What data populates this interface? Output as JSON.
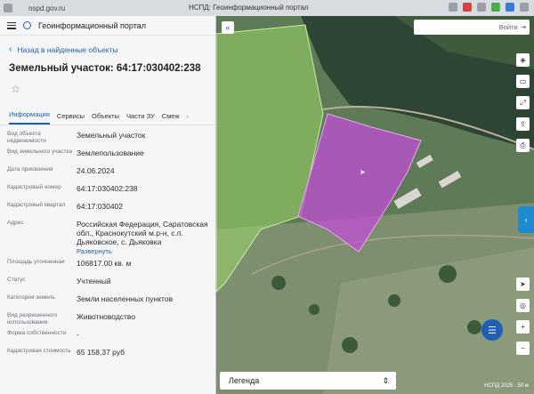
{
  "browser": {
    "url": "nspd.gov.ru",
    "window_title": "НСПД: Геоинформационный портал"
  },
  "panel": {
    "app_title": "Геоинформационный портал",
    "back_label": "Назад в найденные объекты",
    "object_title": "Земельный участок: 64:17:030402:238",
    "tabs": [
      {
        "label": "Информация"
      },
      {
        "label": "Сервисы"
      },
      {
        "label": "Объекты"
      },
      {
        "label": "Части ЗУ"
      },
      {
        "label": "Смеж"
      }
    ],
    "fields": [
      {
        "key": "Вид объекта недвижимости",
        "value": "Земельный участок"
      },
      {
        "key": "Вид земельного участка",
        "value": "Землепользование"
      },
      {
        "key": "Дата присвоения",
        "value": "24.06.2024"
      },
      {
        "key": "Кадастровый номер",
        "value": "64:17:030402:238"
      },
      {
        "key": "Кадастровый квартал",
        "value": "64:17:030402"
      },
      {
        "key": "Адрес",
        "value": "Российская Федерация, Саратовская обл., Краснокутский м.р-н, с.п. Дьяковское, с. Дьяковка",
        "more": "Развернуть"
      },
      {
        "key": "Площадь уточненная",
        "value": "106817.00 кв. м"
      },
      {
        "key": "Статус",
        "value": "Учтенный"
      },
      {
        "key": "Категория земель",
        "value": "Земли населенных пунктов"
      },
      {
        "key": "Вид разрешенного использования",
        "value": "Животноводство"
      },
      {
        "key": "Форма собственности",
        "value": "-"
      },
      {
        "key": "Кадастровая стоимость",
        "value": "65 158,37 руб"
      }
    ]
  },
  "map": {
    "search_placeholder": "Войти",
    "legend_label": "Легенда",
    "scale_text": "НСПД 2025 · 50 м"
  },
  "colors": {
    "accent": "#1e5fb3",
    "parcel_fill": "#c04fd6",
    "green_area": "#9bd66a"
  }
}
